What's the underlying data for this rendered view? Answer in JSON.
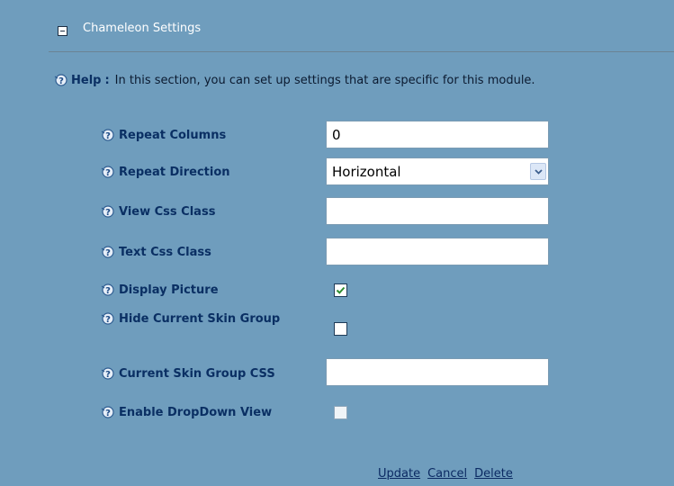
{
  "section": {
    "title": "Chameleon Settings"
  },
  "help": {
    "label": "Help",
    "colon": ":",
    "text": "In this section, you can set up settings that are specific for this module."
  },
  "fields": {
    "repeat_columns": {
      "label": "Repeat Columns",
      "value": "0"
    },
    "repeat_direction": {
      "label": "Repeat Direction",
      "value": "Horizontal"
    },
    "view_css_class": {
      "label": "View Css Class",
      "value": ""
    },
    "text_css_class": {
      "label": "Text Css Class",
      "value": ""
    },
    "display_picture": {
      "label": "Display Picture",
      "checked": true
    },
    "hide_current_skin_group": {
      "label": "Hide Current Skin Group",
      "checked": false
    },
    "current_skin_group_css": {
      "label": "Current Skin Group CSS",
      "value": ""
    },
    "enable_dropdown_view": {
      "label": "Enable DropDown View",
      "checked": false,
      "disabled": true
    }
  },
  "actions": {
    "update": "Update",
    "cancel": "Cancel",
    "delete": "Delete"
  },
  "icons": {
    "collapse": "minus-box-icon",
    "help": "help-question-icon",
    "dropdown": "chevron-down-icon",
    "check": "check-icon"
  },
  "colors": {
    "background": "#6f9dbd",
    "label": "#0a2f63",
    "check": "#2e8b2e"
  }
}
